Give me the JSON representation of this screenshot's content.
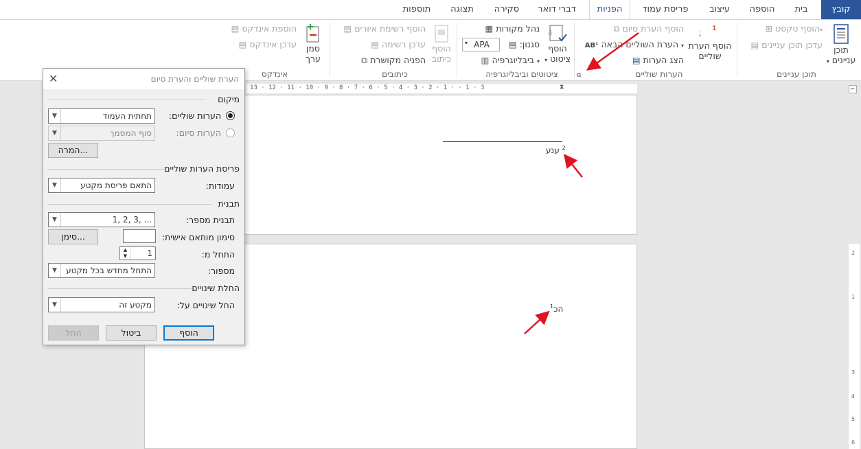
{
  "tabs": [
    {
      "label": "קובץ"
    },
    {
      "label": "בית"
    },
    {
      "label": "הוספה"
    },
    {
      "label": "עיצוב"
    },
    {
      "label": "פריסת עמוד"
    },
    {
      "label": "הפניות"
    },
    {
      "label": "דברי דואר"
    },
    {
      "label": "סקירה"
    },
    {
      "label": "תצוגה"
    },
    {
      "label": "תוספות"
    }
  ],
  "ribbon": {
    "toc": {
      "group": "תוכן עניינים",
      "big_label_1": "תוכן",
      "big_label_2": "עניינים",
      "add_text": "הוסף טקסט",
      "update_toc": "עדכן תוכן עניינים"
    },
    "footnotes": {
      "group": "הערות שוליים",
      "big_label_1": "הוסף הערת",
      "big_label_2": "שוליים",
      "insert_endnote": "הוסף הערת סיום",
      "next_footnote": "הערת השוליים הבאה",
      "show_notes": "הצג הערות"
    },
    "citations": {
      "group": "ציטוטים וביבליוגרפיה",
      "insert_1": "הוסף",
      "insert_2": "ציטוט",
      "manage": "נהל מקורות",
      "style_label": "סגנון:",
      "style_value": "APA",
      "bibliography": "ביבליוגרפיה"
    },
    "captions": {
      "group": "כיתובים",
      "insert_1": "הוסף",
      "insert_2": "כיתוב",
      "table_of_figures": "הוסף רשימת איורים",
      "update_table": "עדכן רשימה",
      "cross_ref": "הפניה מקושרת"
    },
    "index": {
      "group": "אינדקס",
      "mark_1": "סמן",
      "mark_2": "ערך",
      "insert_index": "הוספת אינדקס",
      "update_index": "עדכן אינדקס"
    }
  },
  "ruler": {
    "numbers": "13 · 12 · 11 · 10 · 9 · 8 · 7 · 6 · 5 · 4 · 3 · 2 · 1 · · 1 · 3"
  },
  "document": {
    "footnote_text": "ענע",
    "footnote_mark": "2",
    "body_text": "הכ",
    "body_mark": "1"
  },
  "dialog": {
    "title": "הערת שוליים והערת סיום",
    "location_section": "מיקום",
    "footnotes_label": "הערות שוליים:",
    "footnotes_value": "תחתית העמוד",
    "endnotes_label": "הערות סיום:",
    "endnotes_value": "סוף המסמך",
    "convert_button": "המרה...",
    "layout_section": "פריסת הערות שוליים",
    "columns_label": "עמודות:",
    "columns_value": "התאם פריסת מקטע",
    "format_section": "תבנית",
    "number_format_label": "תבנית מספר:",
    "number_format_value": "1, 2, 3, ...",
    "custom_mark_label": "סימון מותאם אישית:",
    "symbol_button": "סימן...",
    "start_at_label": "התחל מ:",
    "start_at_value": "1",
    "numbering_label": "מספור:",
    "numbering_value": "התחל מחדש בכל מקטע",
    "apply_section": "החלת שינויים",
    "apply_to_label": "החל שינויים על:",
    "apply_to_value": "מקטע זה",
    "insert_button": "הוסף",
    "cancel_button": "ביטול",
    "apply_button": "החל"
  },
  "colors": {
    "accent": "#2b579a",
    "annotation_arrow": "#e0141e"
  }
}
